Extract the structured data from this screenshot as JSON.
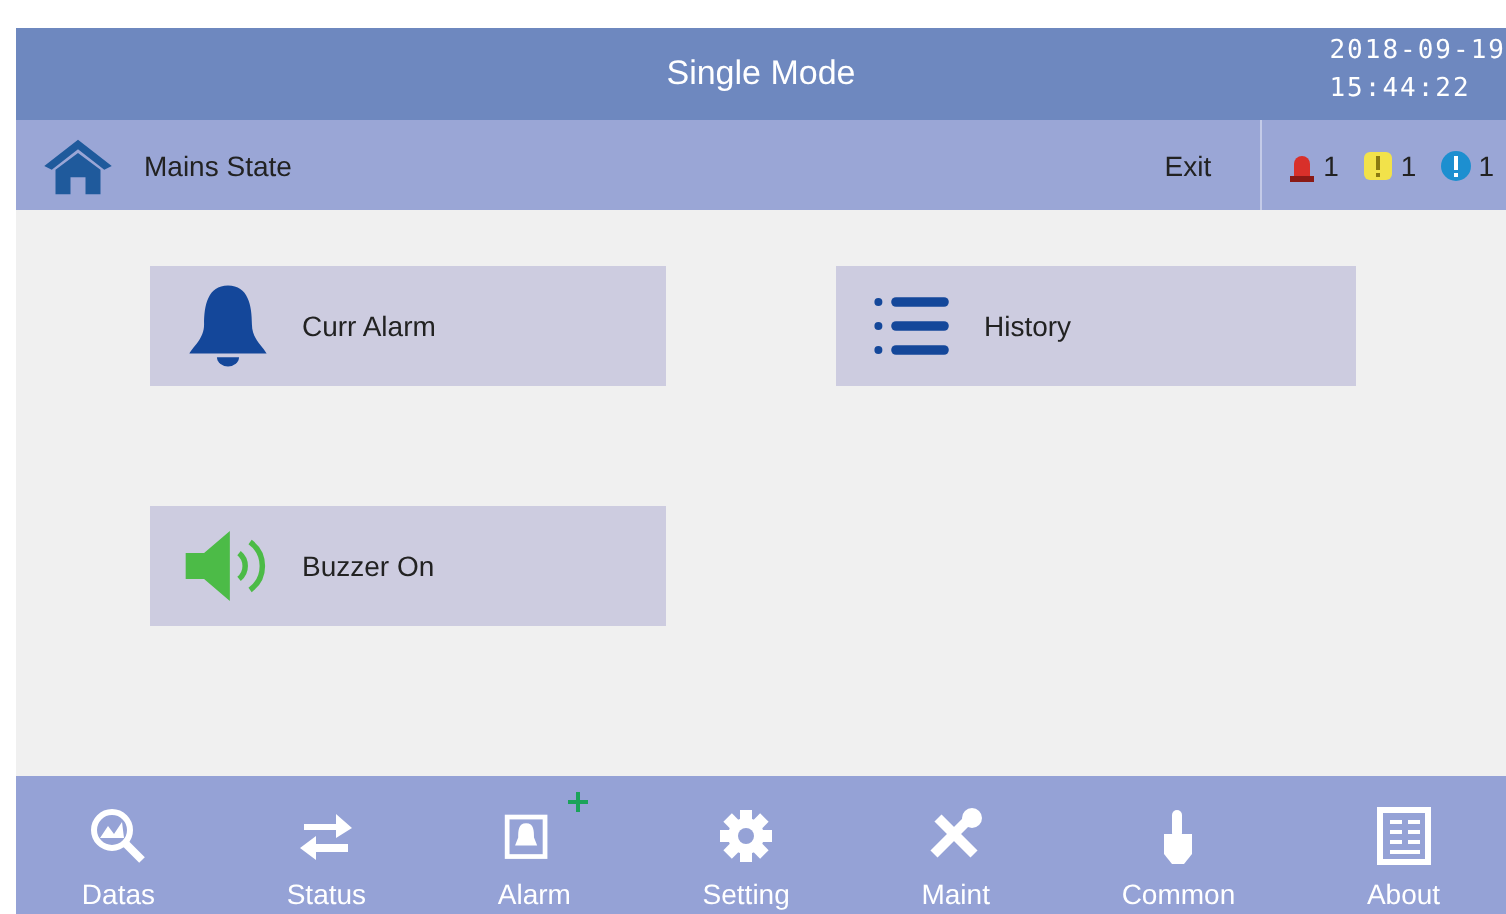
{
  "header": {
    "title": "Single Mode",
    "date": "2018-09-19",
    "time": "15:44:22"
  },
  "subbar": {
    "location": "Mains State",
    "exit": "Exit",
    "alarm_counts": [
      {
        "kind": "critical",
        "count": "1"
      },
      {
        "kind": "warning",
        "count": "1"
      },
      {
        "kind": "info",
        "count": "1"
      }
    ]
  },
  "buttons": [
    {
      "kind": "bell",
      "label": "Curr Alarm"
    },
    {
      "kind": "list",
      "label": "History"
    },
    {
      "kind": "speaker",
      "label": "Buzzer On"
    }
  ],
  "nav": [
    {
      "kind": "datas",
      "label": "Datas"
    },
    {
      "kind": "status",
      "label": "Status"
    },
    {
      "kind": "alarm",
      "label": "Alarm",
      "new": true
    },
    {
      "kind": "setting",
      "label": "Setting"
    },
    {
      "kind": "maint",
      "label": "Maint"
    },
    {
      "kind": "common",
      "label": "Common"
    },
    {
      "kind": "about",
      "label": "About"
    }
  ]
}
